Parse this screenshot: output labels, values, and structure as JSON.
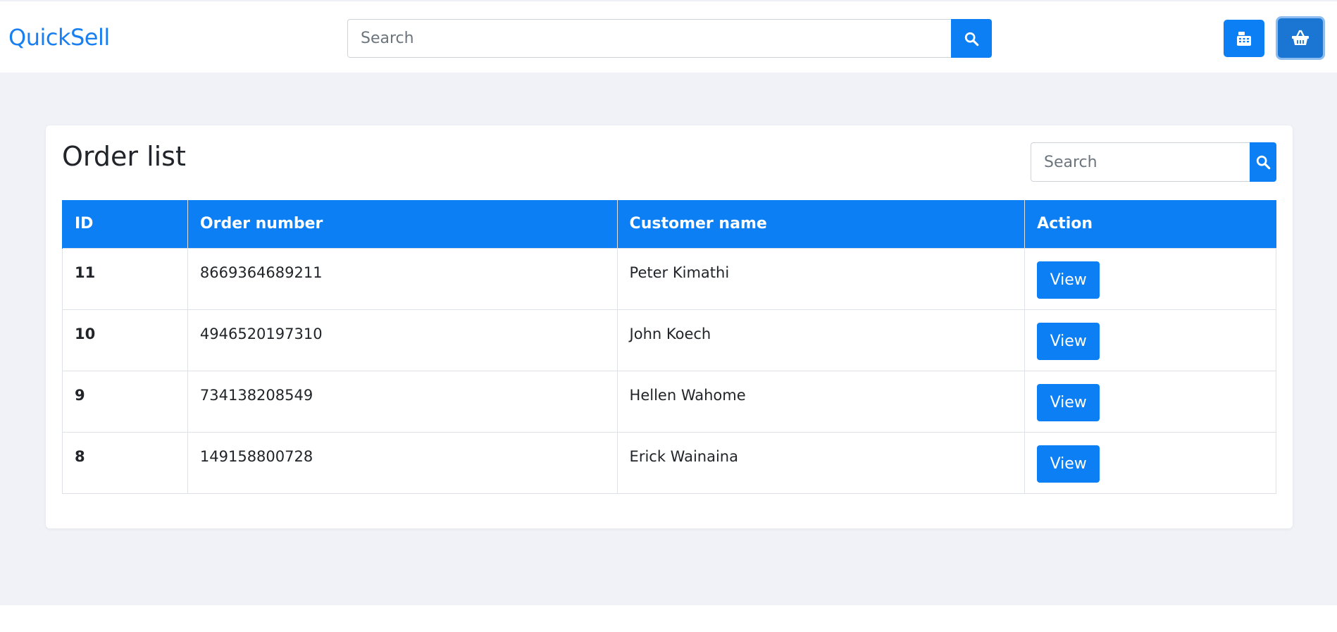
{
  "brand": {
    "name": "QuickSell",
    "color": "#1a7ff0"
  },
  "header": {
    "search": {
      "placeholder": "Search",
      "value": ""
    },
    "search_icon": "search-icon",
    "buttons": [
      {
        "icon": "cash-register-icon"
      },
      {
        "icon": "shopping-basket-icon"
      }
    ]
  },
  "orders": {
    "title": "Order list",
    "search": {
      "placeholder": "Search",
      "value": ""
    },
    "columns": [
      "ID",
      "Order number",
      "Customer name",
      "Action"
    ],
    "rows": [
      {
        "id": "11",
        "order_number": "8669364689211",
        "customer_name": "Peter Kimathi",
        "action": "View"
      },
      {
        "id": "10",
        "order_number": "4946520197310",
        "customer_name": "John Koech",
        "action": "View"
      },
      {
        "id": "9",
        "order_number": "734138208549",
        "customer_name": "Hellen Wahome",
        "action": "View"
      },
      {
        "id": "8",
        "order_number": "149158800728",
        "customer_name": "Erick Wainaina",
        "action": "View"
      }
    ]
  },
  "colors": {
    "primary": "#0d7ff5",
    "background": "#f0f2f7",
    "table_header": "#0d7ff5"
  }
}
